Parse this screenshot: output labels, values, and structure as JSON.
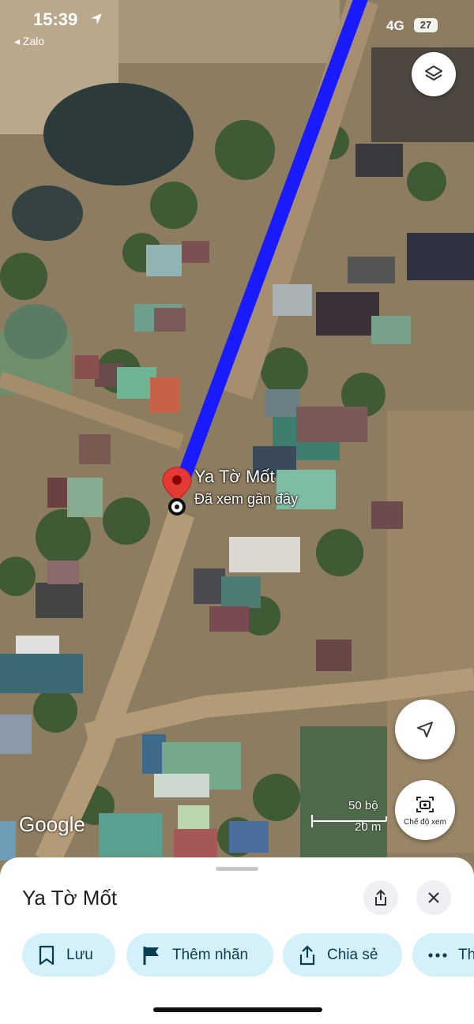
{
  "status_bar": {
    "time": "15:39",
    "back_app": "◂ Zalo",
    "network": "4G",
    "battery": "27"
  },
  "map": {
    "attribution": "Google",
    "pin": {
      "title": "Ya Tờ Mốt",
      "subtitle": "Đã xem gần đây"
    },
    "scale": {
      "imperial": "50 bộ",
      "metric": "20 m"
    },
    "street_view_label": "Chế độ xem",
    "route_color": "#1a1aff",
    "pin_color": "#e53935"
  },
  "sheet": {
    "title": "Ya Tờ Mốt",
    "actions": [
      {
        "label": "Lưu",
        "icon": "bookmark-icon"
      },
      {
        "label": "Thêm nhãn",
        "icon": "flag-icon"
      },
      {
        "label": "Chia sẻ",
        "icon": "share-icon"
      },
      {
        "label": "Th",
        "icon": "more-icon"
      }
    ],
    "chip_color": "#d4f1fa"
  }
}
